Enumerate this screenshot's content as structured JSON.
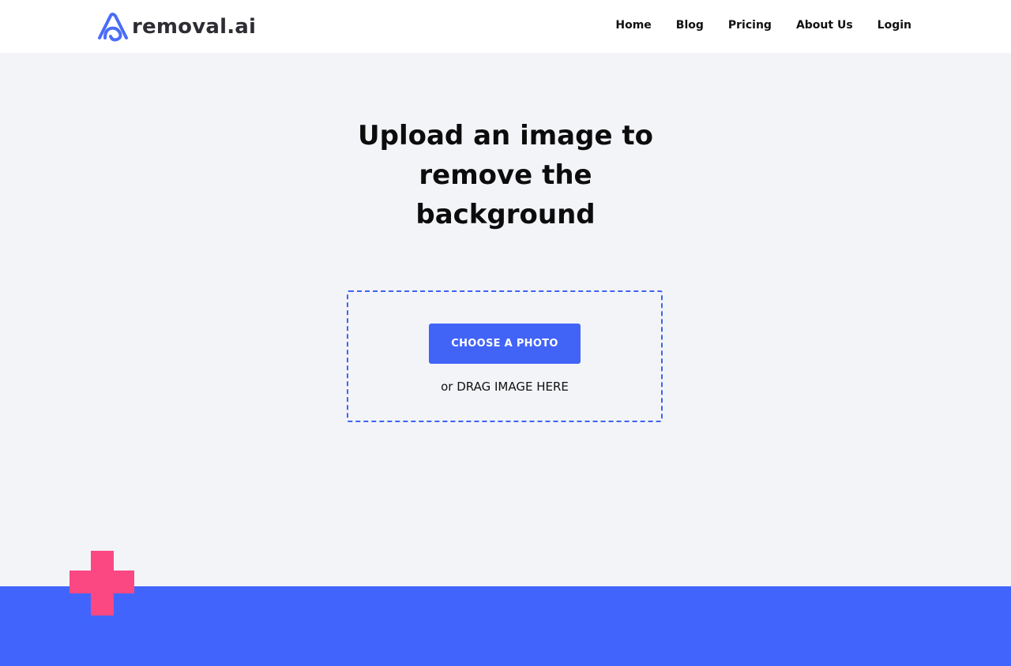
{
  "brand": {
    "name": "removal.ai",
    "logo_icon": "removal-ai-logo-icon",
    "accent_color": "#4164f7"
  },
  "nav": {
    "items": [
      {
        "label": "Home"
      },
      {
        "label": "Blog"
      },
      {
        "label": "Pricing"
      },
      {
        "label": "About Us"
      },
      {
        "label": "Login"
      }
    ]
  },
  "hero": {
    "title_line1": "Upload an image to",
    "title_line2": "remove the",
    "title_line3": "background"
  },
  "upload": {
    "button_label": "CHOOSE A PHOTO",
    "drag_text": "or DRAG IMAGE HERE"
  },
  "decoration": {
    "plus_color": "#fb4882",
    "band_color": "#4165fc"
  }
}
